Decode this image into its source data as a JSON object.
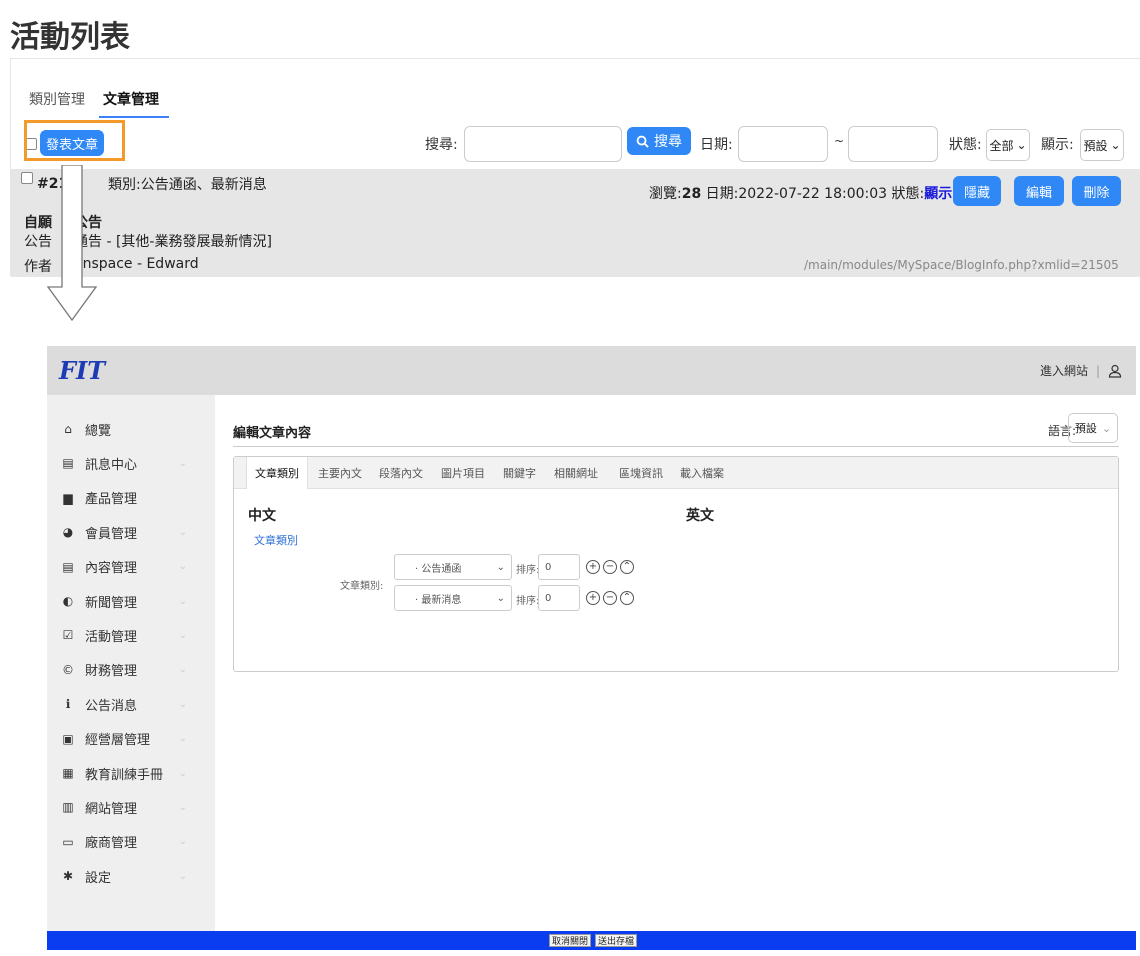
{
  "top": {
    "title": "活動列表",
    "tabs": [
      "類別管理",
      "文章管理"
    ],
    "post_button": "發表文章",
    "search_label": "搜尋:",
    "search_button": "搜尋",
    "date_label": "日期:",
    "date_sep": "~",
    "status_label": "狀態:",
    "status_value": "全部",
    "display_label": "顯示:",
    "display_value": "預設",
    "record": {
      "id": "#21",
      "category": "類別:公告通函、最新消息",
      "views_label": "瀏覽:",
      "views": "28",
      "date": "日期:2022-07-22 18:00:03",
      "status_label": "狀態:",
      "status_value": "顯示",
      "hide": "隱藏",
      "edit": "編輯",
      "delete": "刪除",
      "line1a": "自願",
      "line1b": "公告",
      "line2a": "公告",
      "line2b": "通告 - [其他-業務發展最新情況]",
      "line3a": "作者",
      "line3b": "onspace - Edward",
      "url": "/main/modules/MySpace/BlogInfo.php?xmlid=21505"
    }
  },
  "app": {
    "logo": "FIT",
    "enter_site": "進入網站",
    "header_sep": "|",
    "sidebar": [
      {
        "label": "總覽",
        "icon": "home-icon",
        "glyph": "⌂",
        "chev": false
      },
      {
        "label": "訊息中心",
        "icon": "message-icon",
        "glyph": "▤",
        "chev": true
      },
      {
        "label": "產品管理",
        "icon": "briefcase-icon",
        "glyph": "▆",
        "chev": false
      },
      {
        "label": "會員管理",
        "icon": "member-icon",
        "glyph": "◕",
        "chev": true
      },
      {
        "label": "內容管理",
        "icon": "content-icon",
        "glyph": "▤",
        "chev": true
      },
      {
        "label": "新聞管理",
        "icon": "globe-icon",
        "glyph": "◐",
        "chev": true
      },
      {
        "label": "活動管理",
        "icon": "checkbox-icon",
        "glyph": "☑",
        "chev": true
      },
      {
        "label": "財務管理",
        "icon": "copyright-icon",
        "glyph": "©",
        "chev": true
      },
      {
        "label": "公告消息",
        "icon": "info-icon",
        "glyph": "ℹ",
        "chev": true
      },
      {
        "label": "經營層管理",
        "icon": "board-icon",
        "glyph": "▣",
        "chev": true
      },
      {
        "label": "教育訓練手冊",
        "icon": "manual-icon",
        "glyph": "▦",
        "chev": true
      },
      {
        "label": "網站管理",
        "icon": "store-icon",
        "glyph": "▥",
        "chev": true
      },
      {
        "label": "廠商管理",
        "icon": "archive-icon",
        "glyph": "▭",
        "chev": true
      },
      {
        "label": "設定",
        "icon": "gear-icon",
        "glyph": "✱",
        "chev": true
      }
    ],
    "main_title": "編輯文章內容",
    "language_label": "語言:",
    "language_value": "預設",
    "card_tabs": [
      "文章類別",
      "主要內文",
      "段落內文",
      "圖片項目",
      "關鍵字",
      "相關網址",
      "區塊資訊",
      "載入檔案"
    ],
    "zh_head": "中文",
    "en_head": "英文",
    "zh_link": "文章類別",
    "category_label": "文章類別:",
    "rows": [
      {
        "select": "· 公告通函",
        "sort_label": "排序:",
        "sort": "0"
      },
      {
        "select": "· 最新消息",
        "sort_label": "排序:",
        "sort": "0"
      }
    ],
    "footer": {
      "cancel": "取消關閉",
      "submit": "送出存檔"
    }
  },
  "colors": {
    "accent": "#2f88f5",
    "highlight": "#f39a2b",
    "footer": "#0a3cf0",
    "status": "#1a1adb"
  }
}
